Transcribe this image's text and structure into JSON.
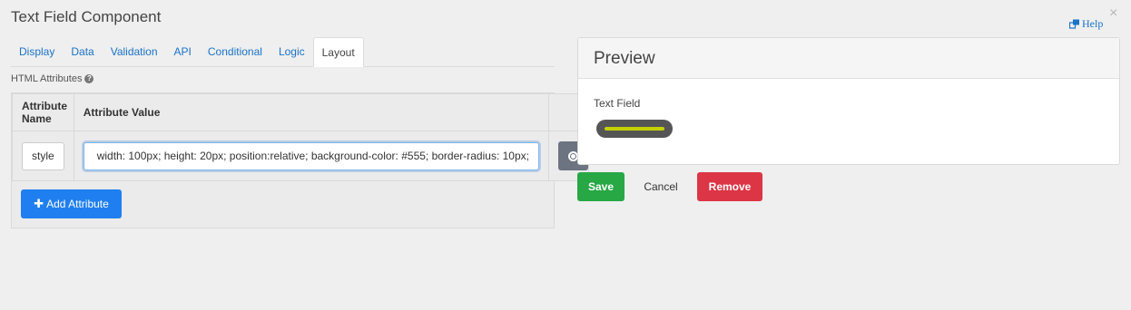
{
  "dialog": {
    "title": "Text Field Component",
    "help_label": "Help",
    "close_glyph": "×"
  },
  "tabs": [
    {
      "label": "Display"
    },
    {
      "label": "Data"
    },
    {
      "label": "Validation"
    },
    {
      "label": "API"
    },
    {
      "label": "Conditional"
    },
    {
      "label": "Logic"
    },
    {
      "label": "Layout",
      "active": true
    }
  ],
  "html_attributes": {
    "section_label": "HTML Attributes",
    "columns": [
      "Attribute Name",
      "Attribute Value"
    ],
    "rows": [
      {
        "name": "style",
        "value": "width: 100px;  height: 20px;  position:relative;  background-color: #555; border-radius: 10px;"
      }
    ],
    "add_button_label": "Add Attribute"
  },
  "preview": {
    "title": "Preview",
    "field_label": "Text Field",
    "field_bg_color": "#555555",
    "field_bar_color": "#c5d200"
  },
  "actions": {
    "save_label": "Save",
    "cancel_label": "Cancel",
    "remove_label": "Remove",
    "save_color": "#28a745",
    "remove_color": "#dc3545"
  }
}
